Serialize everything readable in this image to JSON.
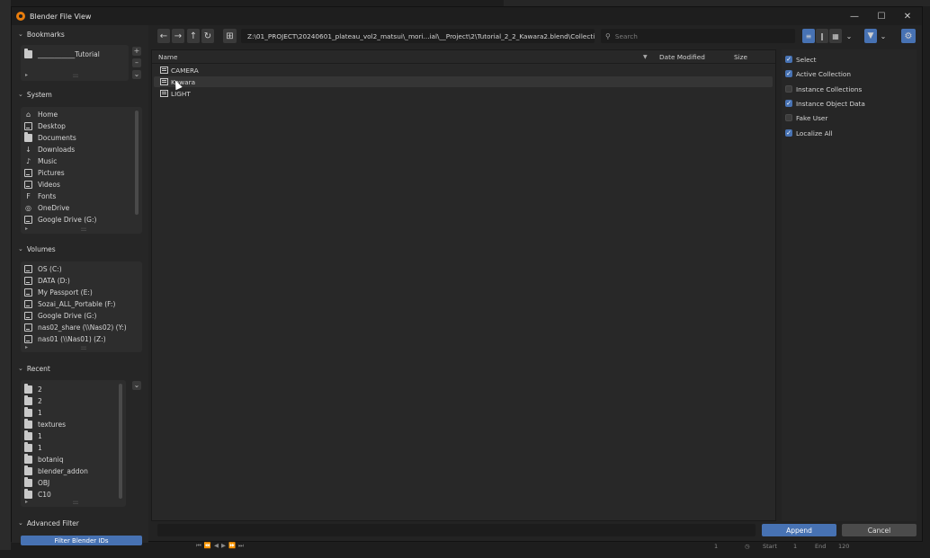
{
  "window": {
    "title": "Blender File View"
  },
  "bookmarks": {
    "header": "Bookmarks",
    "items": [
      {
        "label": "___________Tutorial",
        "icon": "folder-icon"
      }
    ]
  },
  "system": {
    "header": "System",
    "items": [
      {
        "label": "Home",
        "icon": "home-icon"
      },
      {
        "label": "Desktop",
        "icon": "desktop-icon"
      },
      {
        "label": "Documents",
        "icon": "documents-icon"
      },
      {
        "label": "Downloads",
        "icon": "downloads-icon"
      },
      {
        "label": "Music",
        "icon": "music-icon"
      },
      {
        "label": "Pictures",
        "icon": "pictures-icon"
      },
      {
        "label": "Videos",
        "icon": "videos-icon"
      },
      {
        "label": "Fonts",
        "icon": "fonts-icon"
      },
      {
        "label": "OneDrive",
        "icon": "globe-icon"
      },
      {
        "label": "Google Drive (G:)",
        "icon": "drive-icon"
      }
    ]
  },
  "volumes": {
    "header": "Volumes",
    "items": [
      {
        "label": "OS (C:)",
        "icon": "drive-icon"
      },
      {
        "label": "DATA (D:)",
        "icon": "drive-icon"
      },
      {
        "label": "My Passport (E:)",
        "icon": "drive-icon"
      },
      {
        "label": "Sozai_ALL_Portable (F:)",
        "icon": "drive-icon"
      },
      {
        "label": "Google Drive (G:)",
        "icon": "drive-icon"
      },
      {
        "label": "nas02_share (\\\\Nas02) (Y:)",
        "icon": "network-drive-icon"
      },
      {
        "label": "nas01 (\\\\Nas01) (Z:)",
        "icon": "network-drive-icon"
      }
    ]
  },
  "recent": {
    "header": "Recent",
    "items": [
      {
        "label": "2"
      },
      {
        "label": "2"
      },
      {
        "label": "1"
      },
      {
        "label": "textures"
      },
      {
        "label": "1"
      },
      {
        "label": "1"
      },
      {
        "label": "botaniq"
      },
      {
        "label": "blender_addon"
      },
      {
        "label": "OBJ"
      },
      {
        "label": "C10"
      }
    ]
  },
  "advanced_filter": {
    "header": "Advanced Filter",
    "button": "Filter Blender IDs"
  },
  "toolbar": {
    "path": "Z:\\01_PROJECT\\20240601_plateau_vol2_matsui\\_mori...ial\\__Project\\2\\Tutorial_2_2_Kawara2.blend\\Collection\\",
    "search_placeholder": "Search",
    "icons": [
      "back-arrow-icon",
      "forward-arrow-icon",
      "parent-dir-icon",
      "refresh-icon",
      "new-folder-icon"
    ]
  },
  "columns": {
    "name": "Name",
    "date": "Date Modified",
    "size": "Size"
  },
  "files": [
    {
      "name": "CAMERA",
      "icon": "collection-icon"
    },
    {
      "name": "Kawara",
      "icon": "collection-icon"
    },
    {
      "name": "LIGHT",
      "icon": "collection-icon"
    }
  ],
  "options": [
    {
      "label": "Select",
      "checked": true
    },
    {
      "label": "Active Collection",
      "checked": true
    },
    {
      "label": "Instance Collections",
      "checked": false
    },
    {
      "label": "Instance Object Data",
      "checked": true
    },
    {
      "label": "Fake User",
      "checked": false
    },
    {
      "label": "Localize All",
      "checked": true
    }
  ],
  "footer": {
    "append": "Append",
    "cancel": "Cancel",
    "filename": ""
  },
  "timeline": {
    "frame": "1",
    "start_label": "Start",
    "start": "1",
    "end_label": "End",
    "end": "120"
  },
  "accent_color": "#4772b3"
}
